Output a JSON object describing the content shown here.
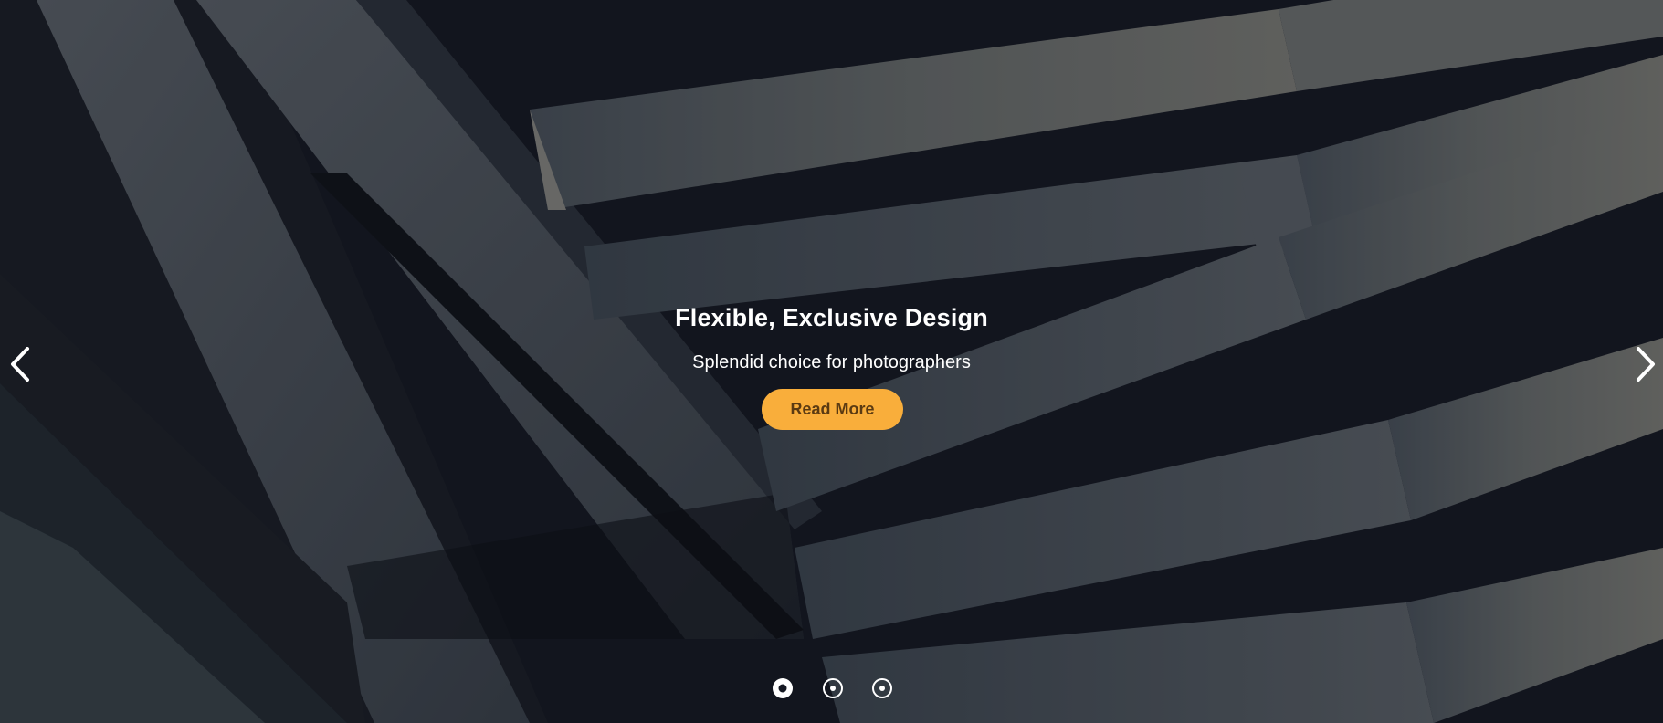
{
  "slider": {
    "background_image": "architecture-building-facade",
    "current_slide": 1,
    "total_slides": 3,
    "caption": {
      "title": "Flexible, Exclusive Design",
      "subtitle": "Splendid choice for photographers",
      "button_label": "Read More"
    },
    "prev_icon": "chevron-left-icon",
    "next_icon": "chevron-right-icon",
    "dots": [
      {
        "active": true
      },
      {
        "active": false
      },
      {
        "active": false
      }
    ]
  },
  "colors": {
    "accent": "#f9ae3b",
    "button_text": "#5a3a12",
    "text": "#ffffff",
    "overlay": "#0d1017"
  }
}
